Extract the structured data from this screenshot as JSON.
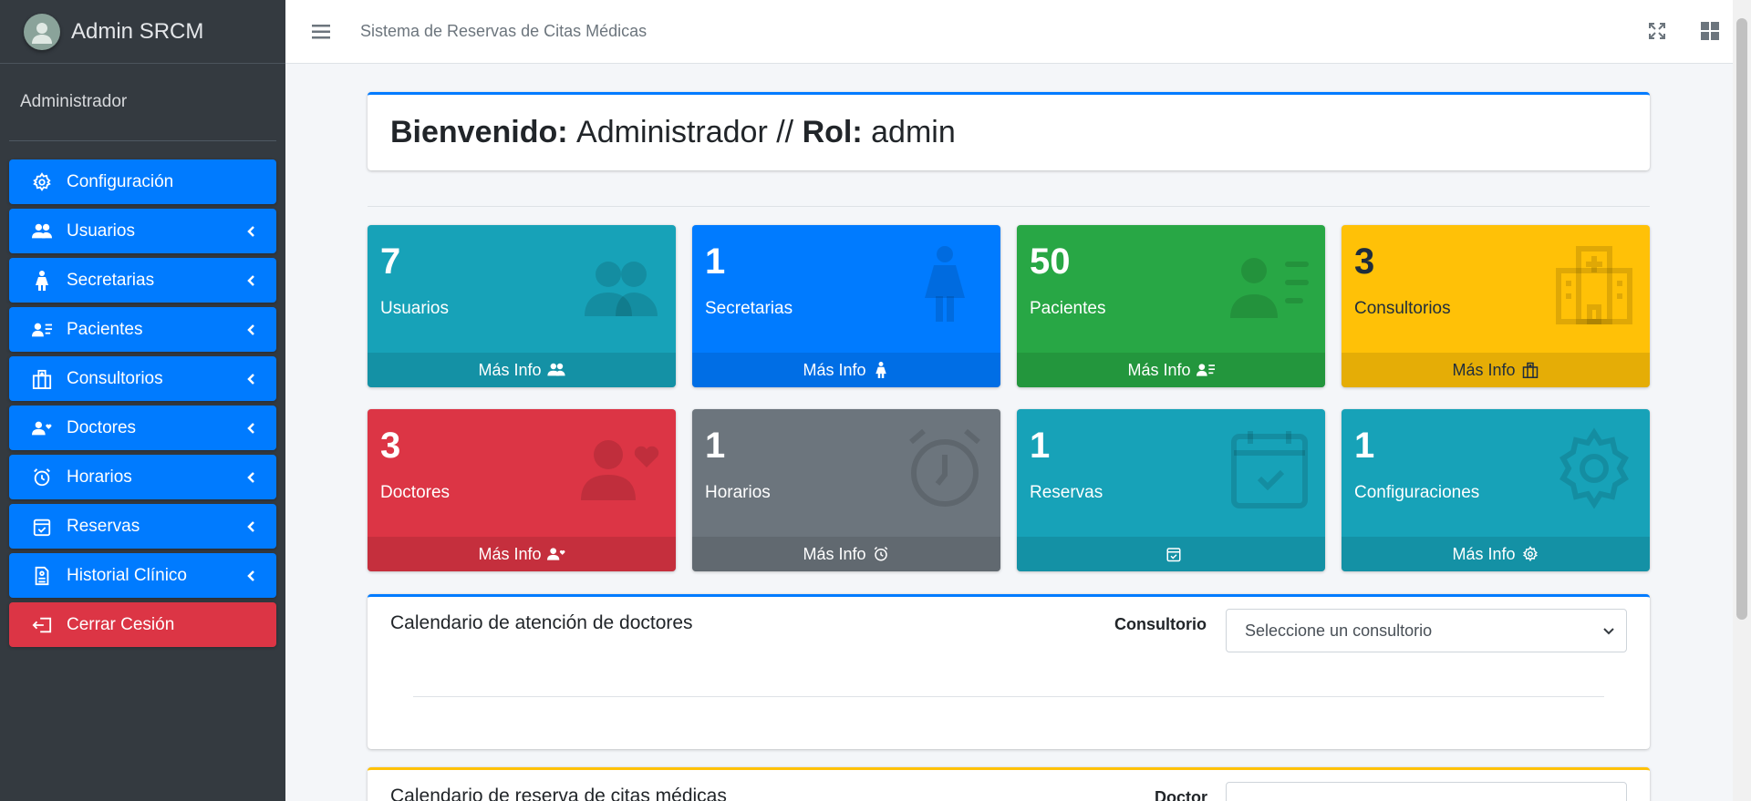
{
  "brand": {
    "name": "Admin SRCM"
  },
  "user": {
    "name": "Administrador"
  },
  "sidebar": {
    "items": [
      {
        "label": "Configuración",
        "icon": "gear-icon",
        "expandable": false
      },
      {
        "label": "Usuarios",
        "icon": "users-icon",
        "expandable": true
      },
      {
        "label": "Secretarias",
        "icon": "person-dress-icon",
        "expandable": true
      },
      {
        "label": "Pacientes",
        "icon": "address-card-icon",
        "expandable": true
      },
      {
        "label": "Consultorios",
        "icon": "hospital-icon",
        "expandable": true
      },
      {
        "label": "Doctores",
        "icon": "user-heart-icon",
        "expandable": true
      },
      {
        "label": "Horarios",
        "icon": "alarm-clock-icon",
        "expandable": true
      },
      {
        "label": "Reservas",
        "icon": "calendar-check-icon",
        "expandable": true
      },
      {
        "label": "Historial Clínico",
        "icon": "file-medical-icon",
        "expandable": true
      },
      {
        "label": "Cerrar Cesión",
        "icon": "logout-icon",
        "expandable": false
      }
    ]
  },
  "topbar": {
    "title": "Sistema de Reservas de Citas Médicas"
  },
  "welcome": {
    "prefix": "Bienvenido:",
    "user": "Administrador //",
    "role_label": "Rol:",
    "role": "admin"
  },
  "stats": [
    {
      "count": "7",
      "label": "Usuarios",
      "footer": "Más Info",
      "color": "#17a2b8",
      "icon": "users-icon"
    },
    {
      "count": "1",
      "label": "Secretarias",
      "footer": "Más Info",
      "color": "#007bff",
      "icon": "person-dress-icon"
    },
    {
      "count": "50",
      "label": "Pacientes",
      "footer": "Más Info",
      "color": "#28a745",
      "icon": "address-card-icon"
    },
    {
      "count": "3",
      "label": "Consultorios",
      "footer": "Más Info",
      "color": "#ffc107",
      "icon": "hospital-icon"
    },
    {
      "count": "3",
      "label": "Doctores",
      "footer": "Más Info",
      "color": "#dc3545",
      "icon": "user-heart-icon"
    },
    {
      "count": "1",
      "label": "Horarios",
      "footer": "Más Info",
      "color": "#6c757d",
      "icon": "alarm-clock-icon"
    },
    {
      "count": "1",
      "label": "Reservas",
      "footer": "",
      "color": "#17a2b8",
      "icon": "calendar-check-icon"
    },
    {
      "count": "1",
      "label": "Configuraciones",
      "footer": "Más Info",
      "color": "#17a2b8",
      "icon": "gear-icon"
    }
  ],
  "calendar_doctors": {
    "title": "Calendario de atención de doctores",
    "filter_label": "Consultorio",
    "select_value": "Seleccione un consultorio"
  },
  "calendar_reservas": {
    "title": "Calendario de reserva de citas médicas",
    "filter_label": "Doctor"
  }
}
